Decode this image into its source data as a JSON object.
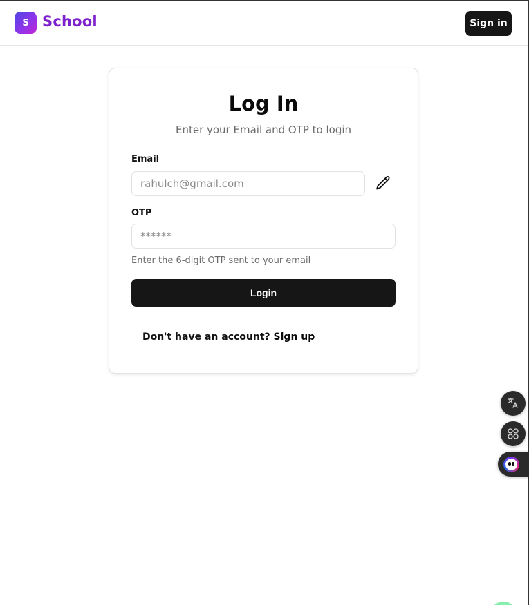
{
  "header": {
    "logo_letter": "S",
    "brand": "School",
    "signin_label": "Sign in"
  },
  "login": {
    "title": "Log In",
    "subtitle": "Enter your Email and OTP to login",
    "email_label": "Email",
    "email_placeholder": "rahulch@gmail.com",
    "otp_label": "OTP",
    "otp_placeholder": "******",
    "otp_hint": "Enter the 6-digit OTP sent to your email",
    "login_button": "Login",
    "signup_prompt": "Don't have an account?",
    "signup_link": "Sign up"
  },
  "icons": {
    "edit": "pencil-icon",
    "translate": "translate-icon",
    "apps": "apps-grid-icon",
    "assistant": "assistant-avatar-icon"
  },
  "colors": {
    "brand": "#7e22ce",
    "primary_button": "#161616"
  }
}
